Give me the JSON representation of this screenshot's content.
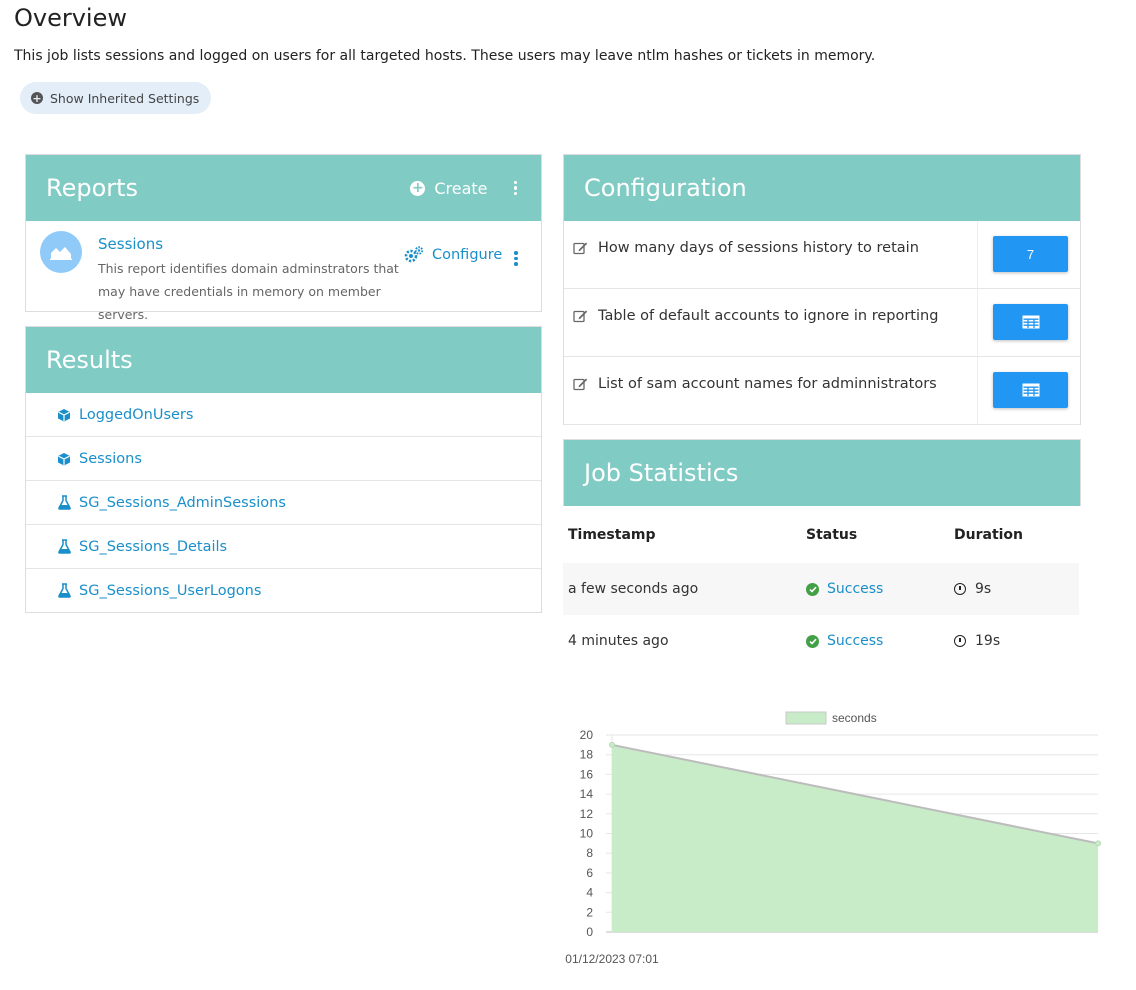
{
  "page": {
    "title": "Overview",
    "description": "This job lists sessions and logged on users for all targeted hosts. These users may leave ntlm hashes or tickets in memory.",
    "inherit_button": "Show Inherited Settings"
  },
  "reports": {
    "title": "Reports",
    "create_label": "Create",
    "items": [
      {
        "name": "Sessions",
        "description": "This report identifies domain adminstrators that may have credentials in memory on member servers.",
        "configure_label": "Configure"
      }
    ]
  },
  "results": {
    "title": "Results",
    "items": [
      {
        "label": "LoggedOnUsers",
        "icon": "cube-icon"
      },
      {
        "label": "Sessions",
        "icon": "cube-icon"
      },
      {
        "label": "SG_Sessions_AdminSessions",
        "icon": "flask-icon"
      },
      {
        "label": "SG_Sessions_Details",
        "icon": "flask-icon"
      },
      {
        "label": "SG_Sessions_UserLogons",
        "icon": "flask-icon"
      }
    ]
  },
  "configuration": {
    "title": "Configuration",
    "items": [
      {
        "label": "How many days of sessions history to retain",
        "value": "7",
        "control": "number"
      },
      {
        "label": "Table of default accounts to ignore in reporting",
        "value": "",
        "control": "table-icon"
      },
      {
        "label": "List of sam account names for adminnistrators",
        "value": "",
        "control": "table-icon"
      }
    ]
  },
  "job_statistics": {
    "title": "Job Statistics",
    "columns": [
      "Timestamp",
      "Status",
      "Duration"
    ],
    "rows": [
      {
        "timestamp": "a few seconds ago",
        "status": "Success",
        "duration": "9s"
      },
      {
        "timestamp": "4 minutes ago",
        "status": "Success",
        "duration": "19s"
      }
    ]
  },
  "colors": {
    "panel_header": "#80cbc4",
    "link": "#1a8fc9",
    "button": "#2196f3",
    "success": "#43a047"
  },
  "chart_data": {
    "type": "area",
    "x": [
      "01/12/2023 07:01",
      ""
    ],
    "series": [
      {
        "name": "seconds",
        "values": [
          19,
          9
        ]
      }
    ],
    "ylim": [
      0,
      20
    ],
    "yticks": [
      0,
      2,
      4,
      6,
      8,
      10,
      12,
      14,
      16,
      18,
      20
    ],
    "grid": true,
    "legend": "top",
    "fill_color": "#c8ecc8",
    "line_color": "#bcbcbc"
  }
}
